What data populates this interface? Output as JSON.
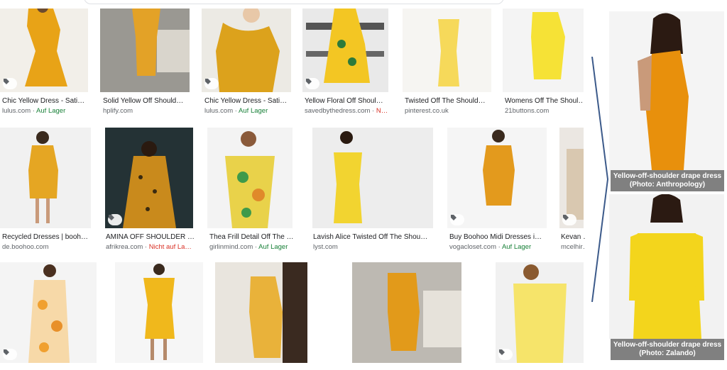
{
  "search": {
    "placeholder": ""
  },
  "results": {
    "row1": [
      {
        "title": "Chic Yellow Dress - Sati…",
        "source": "lulus.com",
        "stock": "Auf Lager",
        "stock_status": "in"
      },
      {
        "title": "Solid Yellow Off Should…",
        "source": "hplify.com",
        "stock": "",
        "stock_status": ""
      },
      {
        "title": "Chic Yellow Dress - Sati…",
        "source": "lulus.com",
        "stock": "Auf Lager",
        "stock_status": "in"
      },
      {
        "title": "Yellow Floral Off Shoul…",
        "source": "savedbythedress.com",
        "stock": "N…",
        "stock_status": "out"
      },
      {
        "title": "Twisted Off The Should…",
        "source": "pinterest.co.uk",
        "stock": "",
        "stock_status": ""
      },
      {
        "title": "Womens Off The Shoul…",
        "source": "21buttons.com",
        "stock": "",
        "stock_status": ""
      }
    ],
    "row2": [
      {
        "title": "Recycled Dresses | booh…",
        "source": "de.boohoo.com",
        "stock": "",
        "stock_status": ""
      },
      {
        "title": "AMINA OFF SHOULDER …",
        "source": "afrikrea.com",
        "stock": "Nicht auf La…",
        "stock_status": "out"
      },
      {
        "title": "Thea Frill Detail Off The …",
        "source": "girlinmind.com",
        "stock": "Auf Lager",
        "stock_status": "in"
      },
      {
        "title": "Lavish Alice Twisted Off The Shou…",
        "source": "lyst.com",
        "stock": "",
        "stock_status": ""
      },
      {
        "title": "Buy Boohoo Midi Dresses i…",
        "source": "vogacloset.com",
        "stock": "Auf Lager",
        "stock_status": "in"
      },
      {
        "title": "Kevan …",
        "source": "mcelhir…",
        "stock": "",
        "stock_status": ""
      }
    ]
  },
  "side_panel": {
    "caption_top": "Yellow-off-shoulder drape dress (Photo: Anthropology)",
    "caption_bottom": "Yellow-off-shoulder drape dress (Photo: Zalando)"
  },
  "colors": {
    "in_stock": "#188038",
    "out_of_stock": "#d93025",
    "caption_bg": "#808080",
    "arrow": "#3c5a8a"
  },
  "icons": {
    "tag": "tag-icon"
  }
}
